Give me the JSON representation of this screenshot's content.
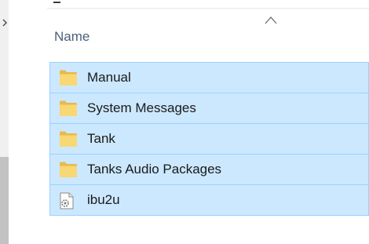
{
  "header": {
    "column_name": "Name",
    "sort_indicator_icon": "chevron-up-icon"
  },
  "files": [
    {
      "name": "Manual",
      "icon": "folder-icon"
    },
    {
      "name": "System Messages",
      "icon": "folder-icon"
    },
    {
      "name": "Tank",
      "icon": "folder-icon"
    },
    {
      "name": "Tanks Audio Packages",
      "icon": "folder-icon"
    },
    {
      "name": "ibu2u",
      "icon": "settings-file-icon"
    }
  ],
  "colors": {
    "selection_fill": "#cce8ff",
    "selection_border": "#99d1ff",
    "folder": "#f8d775",
    "header_text": "#4c607a"
  }
}
